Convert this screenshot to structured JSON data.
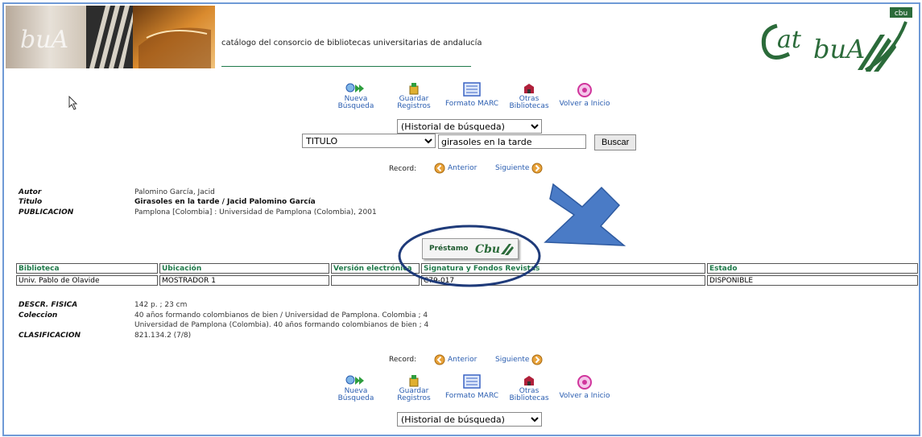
{
  "banner": {
    "text": "catálogo del consorcio de bibliotecas universitarias de andalucía",
    "logo_text": "cat buA",
    "logo_tag": "cbu"
  },
  "toolbar": {
    "items": [
      {
        "label1": "Nueva",
        "label2": "Búsqueda",
        "icon": "search-arrow-icon"
      },
      {
        "label1": "Guardar",
        "label2": "Registros",
        "icon": "save-icon"
      },
      {
        "label1": "Formato MARC",
        "label2": "",
        "icon": "marc-icon"
      },
      {
        "label1": "Otras",
        "label2": "Bibliotecas",
        "icon": "library-icon"
      },
      {
        "label1": "Volver a Inicio",
        "label2": "",
        "icon": "home-icon"
      }
    ]
  },
  "search": {
    "history": "(Historial de búsqueda)",
    "field": "TITULO",
    "query": "girasoles en la tarde",
    "button": "Buscar"
  },
  "record_nav": {
    "label": "Record:",
    "prev": "Anterior",
    "next": "Siguiente"
  },
  "record": {
    "autor_label": "Autor",
    "autor": "Palomino García, Jacid",
    "titulo_label": "Titulo",
    "titulo": "Girasoles en la tarde / Jacid Palomino García",
    "pub_label": "PUBLICACION",
    "publicacion": "Pamplona [Colombia] : Universidad de Pamplona (Colombia), 2001"
  },
  "loan": {
    "label": "Préstamo",
    "logo": "CbuA"
  },
  "holdings": {
    "headers": [
      "Biblioteca",
      "Ubicación",
      "Versión electrónica",
      "Signatura y Fondos Revistas",
      "Estado"
    ],
    "row": [
      "Univ. Pablo de Olavide",
      "MOSTRADOR 1",
      "",
      "C79-017",
      "DISPONIBLE"
    ]
  },
  "details": {
    "descr_label": "DESCR. FISICA",
    "descr": "142 p. ; 23 cm",
    "coleccion_label": "Coleccion",
    "coleccion1": "40 años formando colombianos de bien / Universidad de Pamplona. Colombia ; 4",
    "coleccion2": "Universidad de Pamplona (Colombia). 40 años formando colombianos de bien ; 4",
    "clasif_label": "CLASIFICACION",
    "clasificacion": "821.134.2 (7/8)"
  },
  "colors": {
    "accent_green": "#1f7a4a",
    "link_blue": "#2a5db0",
    "annotation_blue": "#4a7bc6",
    "ellipse_navy": "#1f3b7a"
  }
}
